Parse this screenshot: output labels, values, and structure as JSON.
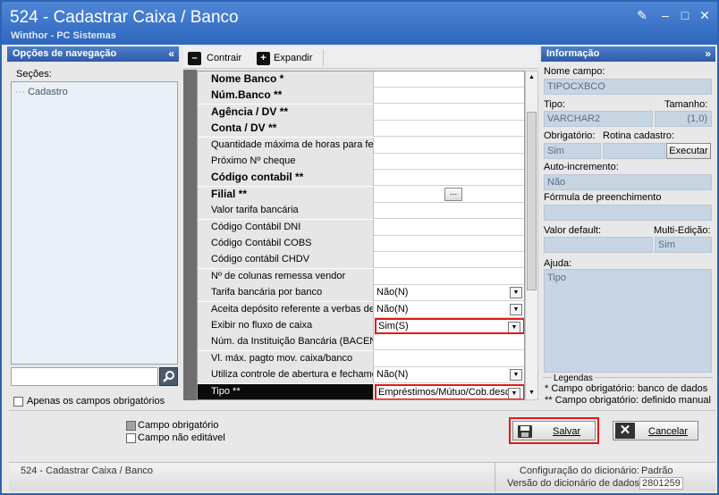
{
  "window": {
    "title": "524 - Cadastrar Caixa / Banco",
    "subtitle": "Winthor - PC Sistemas"
  },
  "nav": {
    "header": "Opções de navegação",
    "sections_label": "Seções:",
    "tree_item": "Cadastro",
    "only_required": "Apenas os campos obrigatórios"
  },
  "toolbar": {
    "collapse": "Contrair",
    "expand": "Expandir"
  },
  "fields": [
    {
      "name": "Nome Banco *",
      "bold": true,
      "value": "",
      "control": "text"
    },
    {
      "name": "Núm.Banco **",
      "bold": true,
      "value": "",
      "control": "text"
    },
    {
      "name": "Agência / DV **",
      "bold": true,
      "value": "",
      "control": "text"
    },
    {
      "name": "Conta / DV **",
      "bold": true,
      "value": "",
      "control": "text"
    },
    {
      "name": "Quantidade máxima de horas para fe",
      "bold": false,
      "value": "",
      "control": "text"
    },
    {
      "name": "Próximo Nº cheque",
      "bold": false,
      "value": "",
      "control": "text"
    },
    {
      "name": "Código contabil **",
      "bold": true,
      "value": "",
      "control": "text"
    },
    {
      "name": "Filial **",
      "bold": true,
      "value": "",
      "control": "lookup"
    },
    {
      "name": "Valor tarifa bancária",
      "bold": false,
      "value": "",
      "control": "text"
    },
    {
      "name": "Código Contábil DNI",
      "bold": false,
      "value": "",
      "control": "text"
    },
    {
      "name": "Código Contábil COBS",
      "bold": false,
      "value": "",
      "control": "text"
    },
    {
      "name": "Código contábil CHDV",
      "bold": false,
      "value": "",
      "control": "text"
    },
    {
      "name": "Nº de colunas remessa vendor",
      "bold": false,
      "value": "",
      "control": "text"
    },
    {
      "name": "Tarifa bancária por banco",
      "bold": false,
      "value": "Não(N)",
      "control": "select"
    },
    {
      "name": "Aceita depósito referente a verbas de",
      "bold": false,
      "value": "Não(N)",
      "control": "select"
    },
    {
      "name": "Exibir no fluxo de caixa",
      "bold": false,
      "value": "Sim(S)",
      "control": "select",
      "highlight": true
    },
    {
      "name": "Núm. da Instituição Bancária (BACEN)",
      "bold": false,
      "value": "",
      "control": "text"
    },
    {
      "name": "Vl. máx. pagto mov. caixa/banco",
      "bold": false,
      "value": "",
      "control": "text"
    },
    {
      "name": "Utiliza controle de abertura e fechame",
      "bold": false,
      "value": "Não(N)",
      "control": "select"
    },
    {
      "name": "Tipo **",
      "bold": false,
      "value": "Empréstimos/Mútuo/Cob.descon",
      "control": "select",
      "highlight": true,
      "selected": true
    }
  ],
  "info": {
    "header": "Informação",
    "field_name_label": "Nome campo:",
    "field_name": "TIPOCXBCO",
    "type_label": "Tipo:",
    "size_label": "Tamanho:",
    "type": "VARCHAR2",
    "size": "(1,0)",
    "required_label": "Obrigatório:",
    "routine_label": "Rotina cadastro:",
    "required": "Sim",
    "execute": "Executar",
    "autoinc_label": "Auto-incremento:",
    "autoinc": "Não",
    "formula_label": "Fórmula de preenchimento",
    "default_label": "Valor default:",
    "multi_label": "Multi-Edição:",
    "multi": "Sim",
    "help_label": "Ajuda:",
    "help": "Tipo",
    "legend_title": "Legendas",
    "legend1": "* Campo obrigatório: banco de dados",
    "legend2": "** Campo obrigatório: definido manual"
  },
  "bottom": {
    "required_field": "Campo obrigatório",
    "non_editable": "Campo não editável",
    "save": "Salvar",
    "cancel": "Cancelar"
  },
  "status": {
    "left": "524 - Cadastrar Caixa / Banco",
    "config_label": "Configuração do dicionário:",
    "config_value": "Padrão",
    "version_label": "Versão do dicionário de dados:",
    "version_value": "2801259"
  }
}
